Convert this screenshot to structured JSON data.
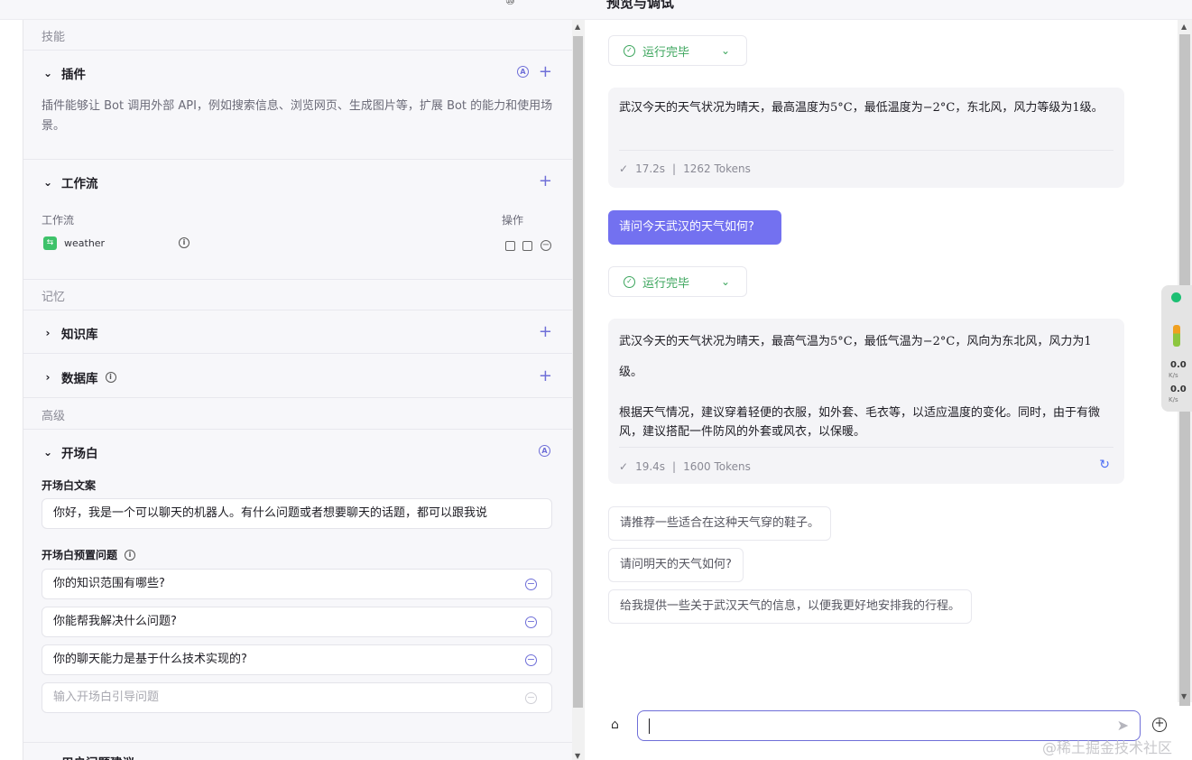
{
  "header": {
    "title": "预览与调试",
    "mark": "⑩"
  },
  "left": {
    "skills_label": "技能",
    "plugins": {
      "title": "插件",
      "auto": "A",
      "desc": "插件能够让 Bot 调用外部 API，例如搜索信息、浏览网页、生成图片等，扩展 Bot 的能力和使用场景。"
    },
    "workflow": {
      "title": "工作流",
      "col_name": "工作流",
      "col_ops": "操作",
      "items": [
        {
          "name": "weather"
        }
      ]
    },
    "memory_label": "记忆",
    "knowledge": {
      "title": "知识库"
    },
    "database": {
      "title": "数据库"
    },
    "advanced_label": "高级",
    "opening": {
      "title": "开场白",
      "auto": "A",
      "text_label": "开场白文案",
      "text_value": "你好，我是一个可以聊天的机器人。有什么问题或者想要聊天的话题，都可以跟我说",
      "questions_label": "开场白预置问题",
      "questions": [
        "你的知识范围有哪些?",
        "你能帮我解决什么问题?",
        "你的聊天能力是基于什么技术实现的?"
      ],
      "question_placeholder": "输入开场白引导问题"
    },
    "bottom_partial": "用户问题建议"
  },
  "chat": {
    "status_1": "运行完毕",
    "answer_1": "武汉今天的天气状况为晴天，最高温度为5°C，最低温度为−2°C，东北风，风力等级为1级。",
    "meta_1": {
      "time": "17.2s",
      "tokens": "1262 Tokens"
    },
    "user_msg": "请问今天武汉的天气如何?",
    "status_2": "运行完毕",
    "answer_2_line1": "武汉今天的天气状况为晴天，最高气温为5°C，最低气温为−2°C，风向为东北风，风力为1级。",
    "answer_2_line2": "根据天气情况，建议穿着轻便的衣服，如外套、毛衣等，以适应温度的变化。同时，由于有微风，建议搭配一件防风的外套或风衣，以保暖。",
    "meta_2": {
      "time": "19.4s",
      "tokens": "1600 Tokens"
    },
    "suggestions": [
      "请推荐一些适合在这种天气穿的鞋子。",
      "请问明天的天气如何?",
      "给我提供一些关于武汉天气的信息，以便我更好地安排我的行程。"
    ],
    "input_value": ""
  },
  "net_widget": {
    "up": "0.0",
    "up_unit": "K/s",
    "down": "0.0",
    "down_unit": "K/s"
  },
  "watermark": "@稀土掘金技术社区",
  "colors": {
    "accent": "#6f6fd8",
    "user_bubble": "#7371f0",
    "success": "#3ba55c"
  }
}
